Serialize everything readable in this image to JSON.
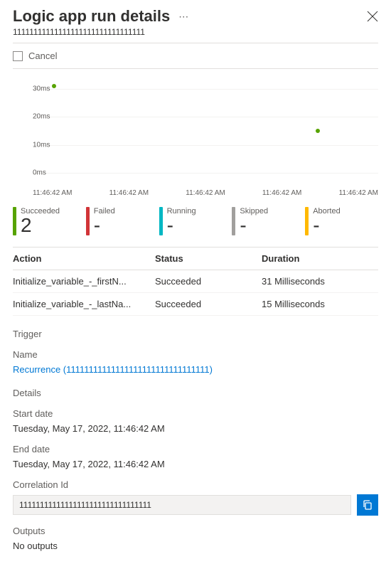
{
  "header": {
    "title": "Logic app run details",
    "run_id": "11111111111111111111111111111111"
  },
  "commandbar": {
    "cancel_label": "Cancel"
  },
  "chart_data": {
    "type": "scatter",
    "y_ticks": [
      "0ms",
      "10ms",
      "20ms",
      "30ms"
    ],
    "x_ticks": [
      "11:46:42 AM",
      "11:46:42 AM",
      "11:46:42 AM",
      "11:46:42 AM",
      "11:46:42 AM"
    ],
    "series": [
      {
        "name": "Succeeded",
        "color": "#57a300",
        "points": [
          {
            "x_index": 0.25,
            "y_ms": 31
          },
          {
            "x_index": 3.3,
            "y_ms": 15
          }
        ]
      }
    ],
    "ylim_ms": [
      0,
      33
    ]
  },
  "status_tiles": [
    {
      "label": "Succeeded",
      "value": "2",
      "color": "#57a300"
    },
    {
      "label": "Failed",
      "value": "-",
      "color": "#d13438"
    },
    {
      "label": "Running",
      "value": "-",
      "color": "#00b7c3"
    },
    {
      "label": "Skipped",
      "value": "-",
      "color": "#a19f9d"
    },
    {
      "label": "Aborted",
      "value": "-",
      "color": "#ffb900"
    }
  ],
  "actions_table": {
    "headers": {
      "action": "Action",
      "status": "Status",
      "duration": "Duration"
    },
    "rows": [
      {
        "action": "Initialize_variable_-_firstN...",
        "status": "Succeeded",
        "duration": "31 Milliseconds"
      },
      {
        "action": "Initialize_variable_-_lastNa...",
        "status": "Succeeded",
        "duration": "15 Milliseconds"
      }
    ]
  },
  "trigger": {
    "section_label": "Trigger",
    "name_label": "Name",
    "name_value": "Recurrence (11111111111111111111111111111111)"
  },
  "details": {
    "section_label": "Details",
    "start_label": "Start date",
    "start_value": "Tuesday, May 17, 2022, 11:46:42 AM",
    "end_label": "End date",
    "end_value": "Tuesday, May 17, 2022, 11:46:42 AM",
    "corr_label": "Correlation Id",
    "corr_value": "11111111111111111111111111111111",
    "outputs_label": "Outputs",
    "outputs_value": "No outputs"
  }
}
